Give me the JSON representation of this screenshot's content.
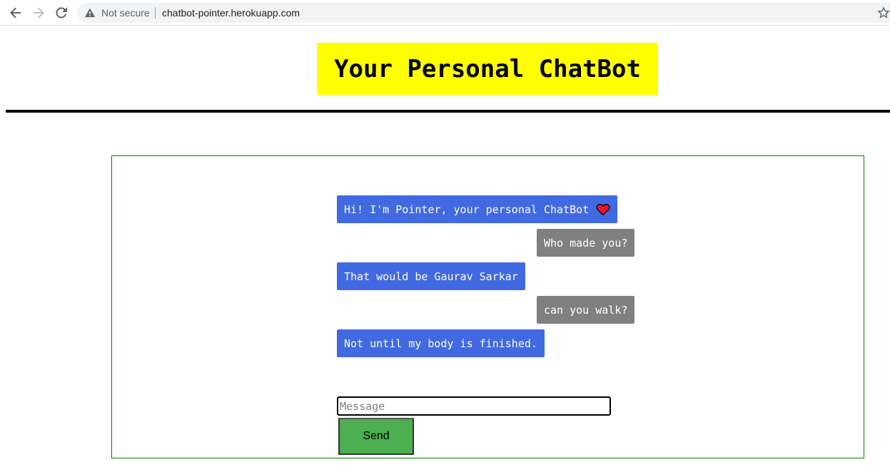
{
  "browser": {
    "security_label": "Not secure",
    "url": "chatbot-pointer.herokuapp.com"
  },
  "header": {
    "title": "Your Personal ChatBot",
    "title_bg": "#ffff00"
  },
  "chat": {
    "messages": [
      {
        "sender": "bot",
        "text": "Hi! I'm Pointer, your personal ChatBot",
        "icon": "heart-icon"
      },
      {
        "sender": "user",
        "text": "Who made you?"
      },
      {
        "sender": "bot",
        "text": "That would be Gaurav Sarkar"
      },
      {
        "sender": "user",
        "text": "can you walk?"
      },
      {
        "sender": "bot",
        "text": "Not until my body is finished."
      }
    ],
    "input_placeholder": "Message",
    "input_value": "",
    "send_label": "Send"
  },
  "colors": {
    "bot_bubble": "#4169e1",
    "user_bubble": "#808080",
    "send_button": "#4caf50",
    "container_border": "#008000"
  }
}
